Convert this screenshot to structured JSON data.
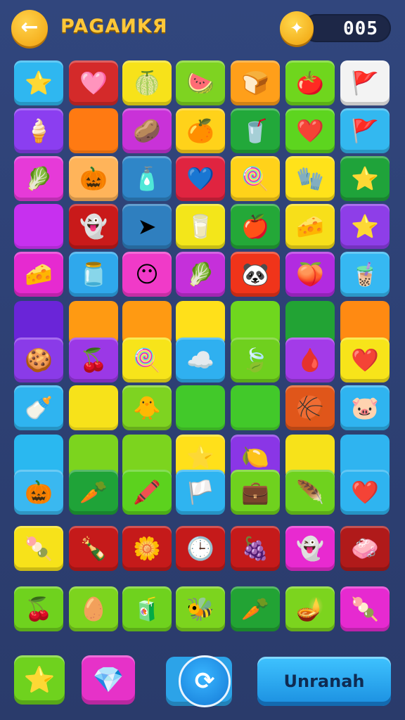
{
  "header": {
    "back_icon": "arrow-left-icon",
    "title": "PAGAИKЯ",
    "coin_icon": "coin-icon",
    "score": "005"
  },
  "colors": {
    "background": "#2b3d6e",
    "title": "#ffc83a",
    "coin": "#f2a20c",
    "action_button": "#1b8fe0"
  },
  "board": {
    "tiles": [
      {
        "color": "#2fb7f0",
        "icon": "star-icon",
        "glyph": "⭐"
      },
      {
        "color": "#d42a2a",
        "icon": "heart-icon",
        "glyph": "🩷"
      },
      {
        "color": "#f7e21a",
        "icon": "melon-icon",
        "glyph": "🍈"
      },
      {
        "color": "#7ed321",
        "icon": "watermelon-icon",
        "glyph": "🍉"
      },
      {
        "color": "#ff9f1a",
        "icon": "bread-icon",
        "glyph": "🍞"
      },
      {
        "color": "#6fd61d",
        "icon": "tomato-icon",
        "glyph": "🍅"
      },
      {
        "color": "#f3f3f3",
        "icon": "flag-icon",
        "glyph": "🚩"
      },
      {
        "color": "#8b3ef0",
        "icon": "ice-cream-icon",
        "glyph": "🍦"
      },
      {
        "color": "#ff7a12",
        "icon": "",
        "glyph": ""
      },
      {
        "color": "#c932d8",
        "icon": "potato-icon",
        "glyph": "🥔"
      },
      {
        "color": "#ffd21a",
        "icon": "pumpkin-icon",
        "glyph": "🍊"
      },
      {
        "color": "#22a83a",
        "icon": "juicer-icon",
        "glyph": "🥤"
      },
      {
        "color": "#5dd51f",
        "icon": "heart-icon",
        "glyph": "❤️"
      },
      {
        "color": "#33b8f0",
        "icon": "flag-icon",
        "glyph": "🚩"
      },
      {
        "color": "#e63ad8",
        "icon": "leaf-icon",
        "glyph": "🥬"
      },
      {
        "color": "#ffb45a",
        "icon": "pumpkin-icon",
        "glyph": "🎃"
      },
      {
        "color": "#2f86c8",
        "icon": "bottle-icon",
        "glyph": "🧴"
      },
      {
        "color": "#e02440",
        "icon": "heart-icon",
        "glyph": "💙"
      },
      {
        "color": "#ffd21a",
        "icon": "popsicle-icon",
        "glyph": "🍭"
      },
      {
        "color": "#ffe21a",
        "icon": "glove-icon",
        "glyph": "🧤"
      },
      {
        "color": "#1fa33a",
        "icon": "star-icon",
        "glyph": "⭐"
      },
      {
        "color": "#c730ef",
        "icon": "",
        "glyph": ""
      },
      {
        "color": "#c91a1a",
        "icon": "ghost-icon",
        "glyph": "👻"
      },
      {
        "color": "#2f7fbf",
        "icon": "arrow-icon",
        "glyph": "➤"
      },
      {
        "color": "#f3e61a",
        "icon": "cup-icon",
        "glyph": "🥛"
      },
      {
        "color": "#24a838",
        "icon": "apple-icon",
        "glyph": "🍎"
      },
      {
        "color": "#f7df1a",
        "icon": "cheese-icon",
        "glyph": "🧀"
      },
      {
        "color": "#8e3ee8",
        "icon": "star-icon",
        "glyph": "⭐"
      },
      {
        "color": "#e62ad0",
        "icon": "cheese-icon",
        "glyph": "🧀"
      },
      {
        "color": "#2fa8ec",
        "icon": "jar-icon",
        "glyph": "🫙"
      },
      {
        "color": "#f03ac8",
        "icon": "face-icon",
        "glyph": "😶"
      },
      {
        "color": "#c530da",
        "icon": "leaf-icon",
        "glyph": "🥬"
      },
      {
        "color": "#f0341a",
        "icon": "panda-icon",
        "glyph": "🐼"
      },
      {
        "color": "#b22be0",
        "icon": "drop-icon",
        "glyph": "🍑"
      },
      {
        "color": "#36b8f2",
        "icon": "bottle-icon",
        "glyph": "🧋"
      },
      {
        "color": "#6a25d8",
        "icon": "",
        "glyph": ""
      },
      {
        "color": "#ff9a12",
        "icon": "",
        "glyph": ""
      },
      {
        "color": "#ff9a12",
        "icon": "",
        "glyph": ""
      },
      {
        "color": "#ffe01a",
        "icon": "",
        "glyph": ""
      },
      {
        "color": "#6fd71e",
        "icon": "",
        "glyph": ""
      },
      {
        "color": "#22a334",
        "icon": "",
        "glyph": ""
      },
      {
        "color": "#ff8a12",
        "icon": "",
        "glyph": ""
      },
      {
        "color": "#8a3be8",
        "icon": "cookie-icon",
        "glyph": "🍪"
      },
      {
        "color": "#9b38e6",
        "icon": "berry-icon",
        "glyph": "🍒"
      },
      {
        "color": "#f7e41a",
        "icon": "lollipop-icon",
        "glyph": "🍭"
      },
      {
        "color": "#2fb0f0",
        "icon": "cloud-icon",
        "glyph": "☁️"
      },
      {
        "color": "#6fd01e",
        "icon": "leaf-icon",
        "glyph": "🍃"
      },
      {
        "color": "#a33be8",
        "icon": "drop-icon",
        "glyph": "🩸"
      },
      {
        "color": "#f7e41a",
        "icon": "heart-icon",
        "glyph": "❤️"
      },
      {
        "color": "#2fb4f0",
        "icon": "bottle-icon",
        "glyph": "🍼"
      },
      {
        "color": "#f7e21a",
        "icon": "",
        "glyph": ""
      },
      {
        "color": "#7ed321",
        "icon": "duck-icon",
        "glyph": "🐥"
      },
      {
        "color": "#42c92a",
        "icon": "",
        "glyph": ""
      },
      {
        "color": "#42c92a",
        "icon": "",
        "glyph": ""
      },
      {
        "color": "#e0561a",
        "icon": "ball-icon",
        "glyph": "🏀"
      },
      {
        "color": "#2fb4f0",
        "icon": "pig-icon",
        "glyph": "🐷"
      },
      {
        "color": "#2ab8f0",
        "icon": "",
        "glyph": ""
      },
      {
        "color": "#7cd41e",
        "icon": "",
        "glyph": ""
      },
      {
        "color": "#7cd41e",
        "icon": "",
        "glyph": ""
      },
      {
        "color": "#ffe01a",
        "icon": "star-icon",
        "glyph": "⭐"
      },
      {
        "color": "#8a36e6",
        "icon": "lemon-icon",
        "glyph": "🍋"
      },
      {
        "color": "#f7e21a",
        "icon": "",
        "glyph": ""
      },
      {
        "color": "#2fb4f0",
        "icon": "",
        "glyph": ""
      },
      {
        "color": "#3ab8f0",
        "icon": "pumpkin-icon",
        "glyph": "🎃"
      },
      {
        "color": "#1fa338",
        "icon": "carrot-icon",
        "glyph": "🥕"
      },
      {
        "color": "#5cd21e",
        "icon": "crayon-icon",
        "glyph": "🖍️"
      },
      {
        "color": "#2fb4f0",
        "icon": "flag-icon",
        "glyph": "🏳️"
      },
      {
        "color": "#6fd21e",
        "icon": "briefcase-icon",
        "glyph": "💼"
      },
      {
        "color": "#6fd21e",
        "icon": "feather-icon",
        "glyph": "🪶"
      },
      {
        "color": "#2fb4f0",
        "icon": "heart-icon",
        "glyph": "❤️"
      },
      {
        "color": "#f7e21a",
        "icon": "popsicle-icon",
        "glyph": "🍡"
      },
      {
        "color": "#c51a1a",
        "icon": "bottle-icon",
        "glyph": "🍾"
      },
      {
        "color": "#c51a1a",
        "icon": "flower-icon",
        "glyph": "🌼"
      },
      {
        "color": "#c51a1a",
        "icon": "clock-icon",
        "glyph": "🕒"
      },
      {
        "color": "#c51a1a",
        "icon": "grape-icon",
        "glyph": "🍇"
      },
      {
        "color": "#e82ad0",
        "icon": "ghost-icon",
        "glyph": "👻"
      },
      {
        "color": "#b01a1a",
        "icon": "soap-icon",
        "glyph": "🧼"
      },
      {
        "color": "#6fd21e",
        "icon": "cherry-icon",
        "glyph": "🍒"
      },
      {
        "color": "#7cd41e",
        "icon": "egg-icon",
        "glyph": "🥚"
      },
      {
        "color": "#6fd21e",
        "icon": "bottle-icon",
        "glyph": "🧃"
      },
      {
        "color": "#7cd41e",
        "icon": "bee-icon",
        "glyph": "🐝"
      },
      {
        "color": "#22a334",
        "icon": "carrot-icon",
        "glyph": "🥕"
      },
      {
        "color": "#7cd41e",
        "icon": "lamp-icon",
        "glyph": "🪔"
      },
      {
        "color": "#e62ad0",
        "icon": "popsicle-icon",
        "glyph": "🍡"
      }
    ]
  },
  "footer": {
    "star_button_icon": "star-icon",
    "star_glyph": "⭐",
    "gem_button_icon": "gem-icon",
    "gem_glyph": "💎",
    "refresh_icon": "refresh-icon",
    "refresh_glyph": "⟳",
    "action_label": "Unranah"
  }
}
